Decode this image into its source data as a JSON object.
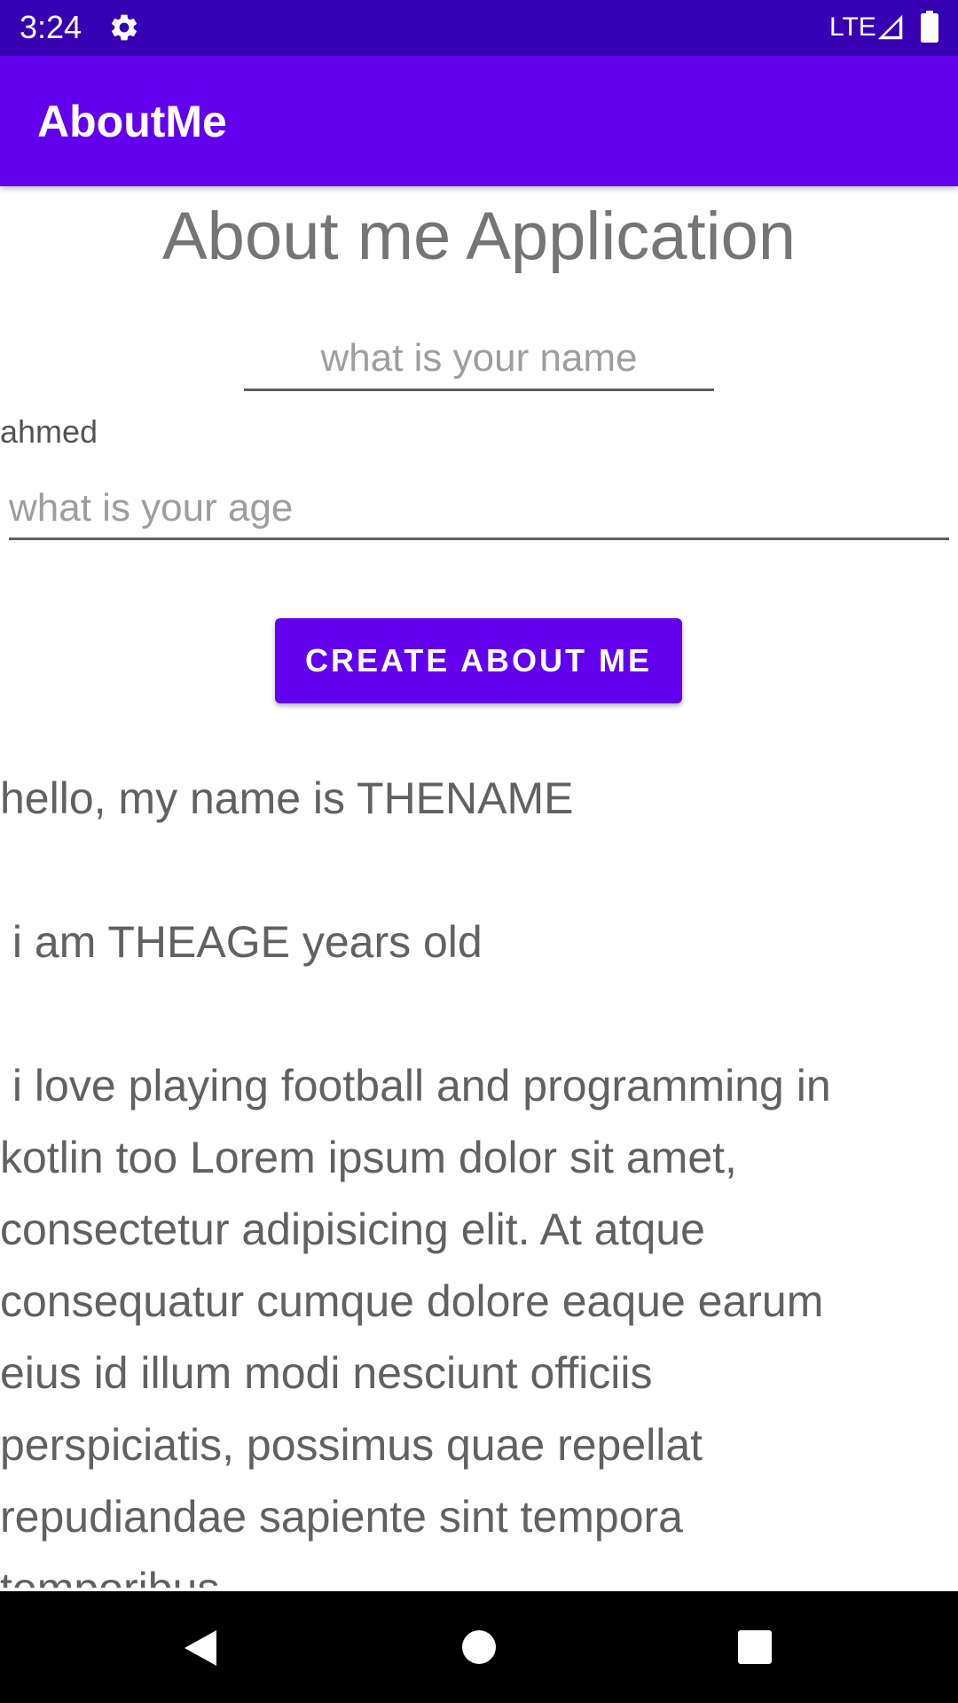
{
  "status_bar": {
    "time": "3:24",
    "network": "LTE",
    "icons": [
      "gear-icon",
      "signal-icon",
      "battery-icon"
    ]
  },
  "app_bar": {
    "title": "AboutMe",
    "color": "#6200ee"
  },
  "main": {
    "title": "About me Application",
    "name_input": {
      "placeholder": "what is your name",
      "value": ""
    },
    "name_text": "ahmed",
    "age_input": {
      "placeholder": "what is your age",
      "value": ""
    },
    "create_button": "CREATE ABOUT ME",
    "about_text": "hello, my name is THENAME\n\n i am THEAGE years old\n\n i love playing football and programming in kotlin too Lorem ipsum dolor sit amet, consectetur adipisicing elit. At atque consequatur cumque dolore eaque earum eius id illum modi nesciunt officiis perspiciatis, possimus quae repellat repudiandae sapiente sint tempora temporibus"
  },
  "nav_bar": {
    "icons": [
      "back-icon",
      "home-icon",
      "recents-icon"
    ]
  },
  "colors": {
    "status_bar": "#3700b3",
    "primary": "#6200ee",
    "text": "#757575"
  }
}
